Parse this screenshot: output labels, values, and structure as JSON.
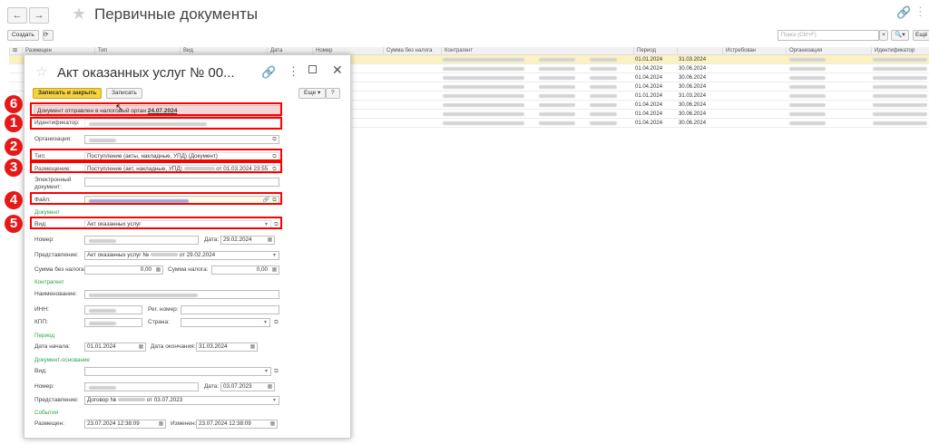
{
  "window": {
    "title": "Первичные документы",
    "nav_back": "←",
    "nav_forward": "→"
  },
  "toolbar": {
    "create_label": "Создать",
    "search_placeholder": "Поиск (Ctrl+F)",
    "more_label": "Ещё"
  },
  "list": {
    "columns": [
      "Размещен",
      "Тип",
      "Вид",
      "Дата",
      "Номер",
      "Сумма без налога",
      "Контрагент",
      "Период",
      "",
      "Истребован",
      "Организация",
      "Идентификатор"
    ],
    "rows": [
      {
        "from": "01.01.2024",
        "to": "31.03.2024"
      },
      {
        "from": "01.04.2024",
        "to": "30.06.2024"
      },
      {
        "from": "01.04.2024",
        "to": "30.06.2024"
      },
      {
        "from": "01.04.2024",
        "to": "30.06.2024"
      },
      {
        "from": "01.01.2024",
        "to": "31.03.2024"
      },
      {
        "from": "01.04.2024",
        "to": "30.06.2024"
      },
      {
        "from": "01.04.2024",
        "to": "30.06.2024"
      },
      {
        "from": "01.04.2024",
        "to": "30.06.2024"
      }
    ]
  },
  "dialog": {
    "title": "Акт оказанных услуг № 00...",
    "save_close_label": "Записать и закрыть",
    "save_label": "Записать",
    "more_label": "Еще",
    "help_label": "?",
    "info_text": "Документ отправлен в налоговый орган",
    "info_date": "24.07.2024",
    "labels": {
      "identifier": "Идентификатор:",
      "organization": "Организация:",
      "type": "Тип:",
      "placement": "Размещение:",
      "edoc": "Электронный документ:",
      "file": "Файл:",
      "kind": "Вид:",
      "number": "Номер:",
      "date": "Дата:",
      "representation": "Представление:",
      "sum": "Сумма без налога:",
      "tax": "Сумма налога:",
      "name": "Наименование:",
      "inn": "ИНН:",
      "regnum": "Рег. номер:",
      "kpp": "КПП:",
      "country": "Страна:",
      "start": "Дата начала:",
      "end": "Дата окончания:",
      "placed": "Размещен:",
      "changed": "Изменен:"
    },
    "sections": {
      "document": "Документ",
      "counterparty": "Контрагент",
      "period": "Период",
      "basis": "Документ-основание",
      "events": "События"
    },
    "values": {
      "type": "Поступление (акты, накладные, УПД) (Документ)",
      "placement_prefix": "Поступление (акт, накладные, УПД)",
      "placement_suffix": "от 01.03.2024 23:55",
      "kind": "Акт оказанных услуг",
      "date": "29.02.2024",
      "repr_prefix": "Акт оказанных услуг №",
      "repr_suffix": "от 29.02.2024",
      "sum": "0,00",
      "tax": "0,00",
      "start": "01.01.2024",
      "end": "31.03.2024",
      "basis_date": "03.07.2023",
      "basis_repr_prefix": "Договор №",
      "basis_repr_suffix": "от 03.07.2023",
      "placed": "23.07.2024 12:38:09",
      "changed": "23.07.2024 12:38:09"
    }
  },
  "badges": [
    "6",
    "1",
    "2",
    "3",
    "4",
    "5"
  ],
  "colors": {
    "highlight_box": "#ff0000",
    "badge": "#e61919",
    "selected_row": "#fbf1c1",
    "primary_button": "#f6d33a",
    "section_label": "#2fa24b"
  }
}
